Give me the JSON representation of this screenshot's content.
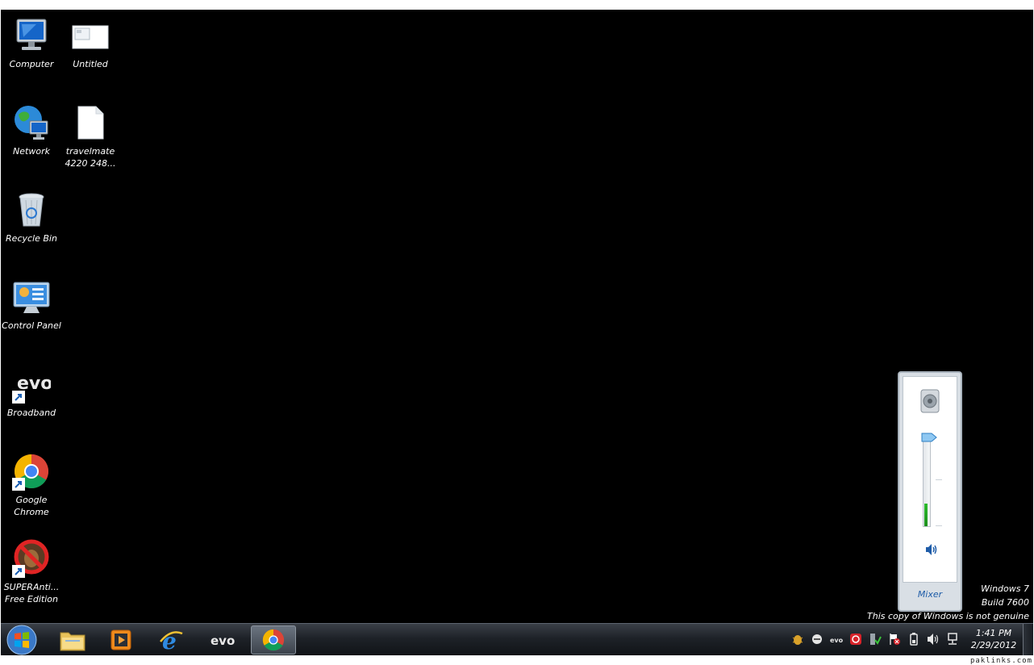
{
  "desktop": {
    "icons": [
      {
        "label": "Computer",
        "icon": "computer-icon"
      },
      {
        "label": "Untitled",
        "icon": "image-file-icon"
      },
      {
        "label": "Network",
        "icon": "network-icon"
      },
      {
        "label": "travelmate\n4220 248...",
        "icon": "blank-file-icon"
      },
      {
        "label": "Recycle Bin",
        "icon": "recycle-bin-icon"
      },
      {
        "label": "Control Panel",
        "icon": "control-panel-icon"
      },
      {
        "label": "Broadband",
        "icon": "evo-icon"
      },
      {
        "label": "Google\nChrome",
        "icon": "chrome-icon"
      },
      {
        "label": "SUPERAnti...\nFree Edition",
        "icon": "superantispyware-icon"
      }
    ]
  },
  "volume_flyout": {
    "mixer_label": "Mixer",
    "level_percent": 100,
    "meter_percent": 25
  },
  "watermark": {
    "line1": "Windows 7",
    "line2": "Build 7600",
    "line3": "This copy of Windows is not genuine"
  },
  "taskbar": {
    "start": "windows-start-icon",
    "pinned": [
      "explorer-icon",
      "media-player-icon",
      "internet-explorer-icon",
      "evo-icon",
      "chrome-icon"
    ],
    "active_app": "chrome-icon",
    "tray_icons": [
      "bug-icon",
      "messenger-icon",
      "evo-icon",
      "antivirus-icon",
      "network-status-icon",
      "action-center-icon",
      "battery-icon",
      "speaker-icon",
      "network-icon"
    ],
    "clock_time": "1:41 PM",
    "clock_date": "2/29/2012"
  },
  "credit": "paklinks.com",
  "colors": {
    "desktop_bg": "#000000",
    "accent": "#1e5ca8",
    "meter_green": "#2cbc2c"
  }
}
